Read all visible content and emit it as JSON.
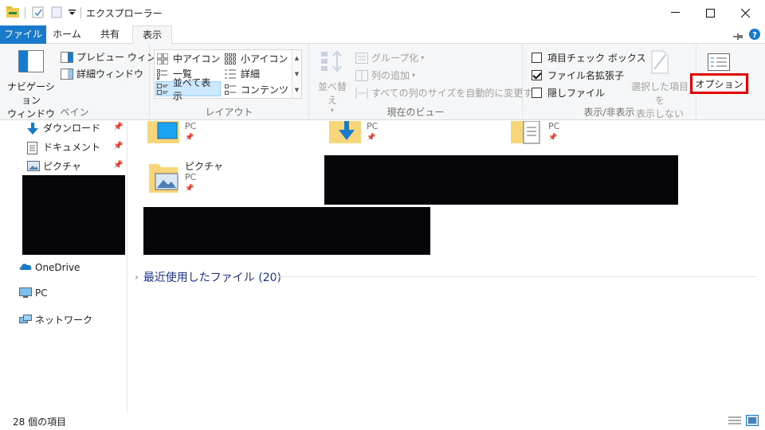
{
  "window": {
    "title": "エクスプローラー"
  },
  "tabs": {
    "file": "ファイル",
    "home": "ホーム",
    "share": "共有",
    "view": "表示"
  },
  "ribbon": {
    "pane": {
      "nav_pane_line1": "ナビゲーション",
      "nav_pane_line2": "ウィンドウ",
      "preview": "プレビュー ウィンドウ",
      "details": "詳細ウィンドウ",
      "label": "ペイン"
    },
    "layout": {
      "items": [
        "中アイコン",
        "小アイコン",
        "一覧",
        "詳細",
        "並べて表示",
        "コンテンツ"
      ],
      "label": "レイアウト"
    },
    "current_view": {
      "sort": "並べ替え",
      "group": "グループ化",
      "add_column": "列の追加",
      "fit_columns": "すべての列のサイズを自動的に変更する",
      "label": "現在のビュー"
    },
    "show_hide": {
      "item_checkboxes": "項目チェック ボックス",
      "item_checkboxes_checked": false,
      "file_extensions": "ファイル名拡張子",
      "file_extensions_checked": true,
      "hidden_items": "隠しファイル",
      "hidden_items_checked": false,
      "hide_selected_line1": "選択した項目を",
      "hide_selected_line2": "表示しない",
      "label": "表示/非表示"
    },
    "options": {
      "label": "オプション",
      "highlight_color": "#e00000"
    }
  },
  "nav": {
    "quick_access": [
      "ダウンロード",
      "ドキュメント",
      "ピクチャ"
    ],
    "onedrive": "OneDrive",
    "pc": "PC",
    "network": "ネットワーク"
  },
  "content": {
    "tiles": [
      {
        "name": "",
        "sub": "PC"
      },
      {
        "name": "",
        "sub": "PC"
      },
      {
        "name": "",
        "sub": "PC"
      },
      {
        "name": "ピクチャ",
        "sub": "PC"
      }
    ],
    "recent_files": "最近使用したファイル (20)"
  },
  "status": {
    "count": "28 個の項目"
  },
  "colors": {
    "accent": "#1979ca",
    "folder": "#f7d67a",
    "link": "#1e3287"
  }
}
